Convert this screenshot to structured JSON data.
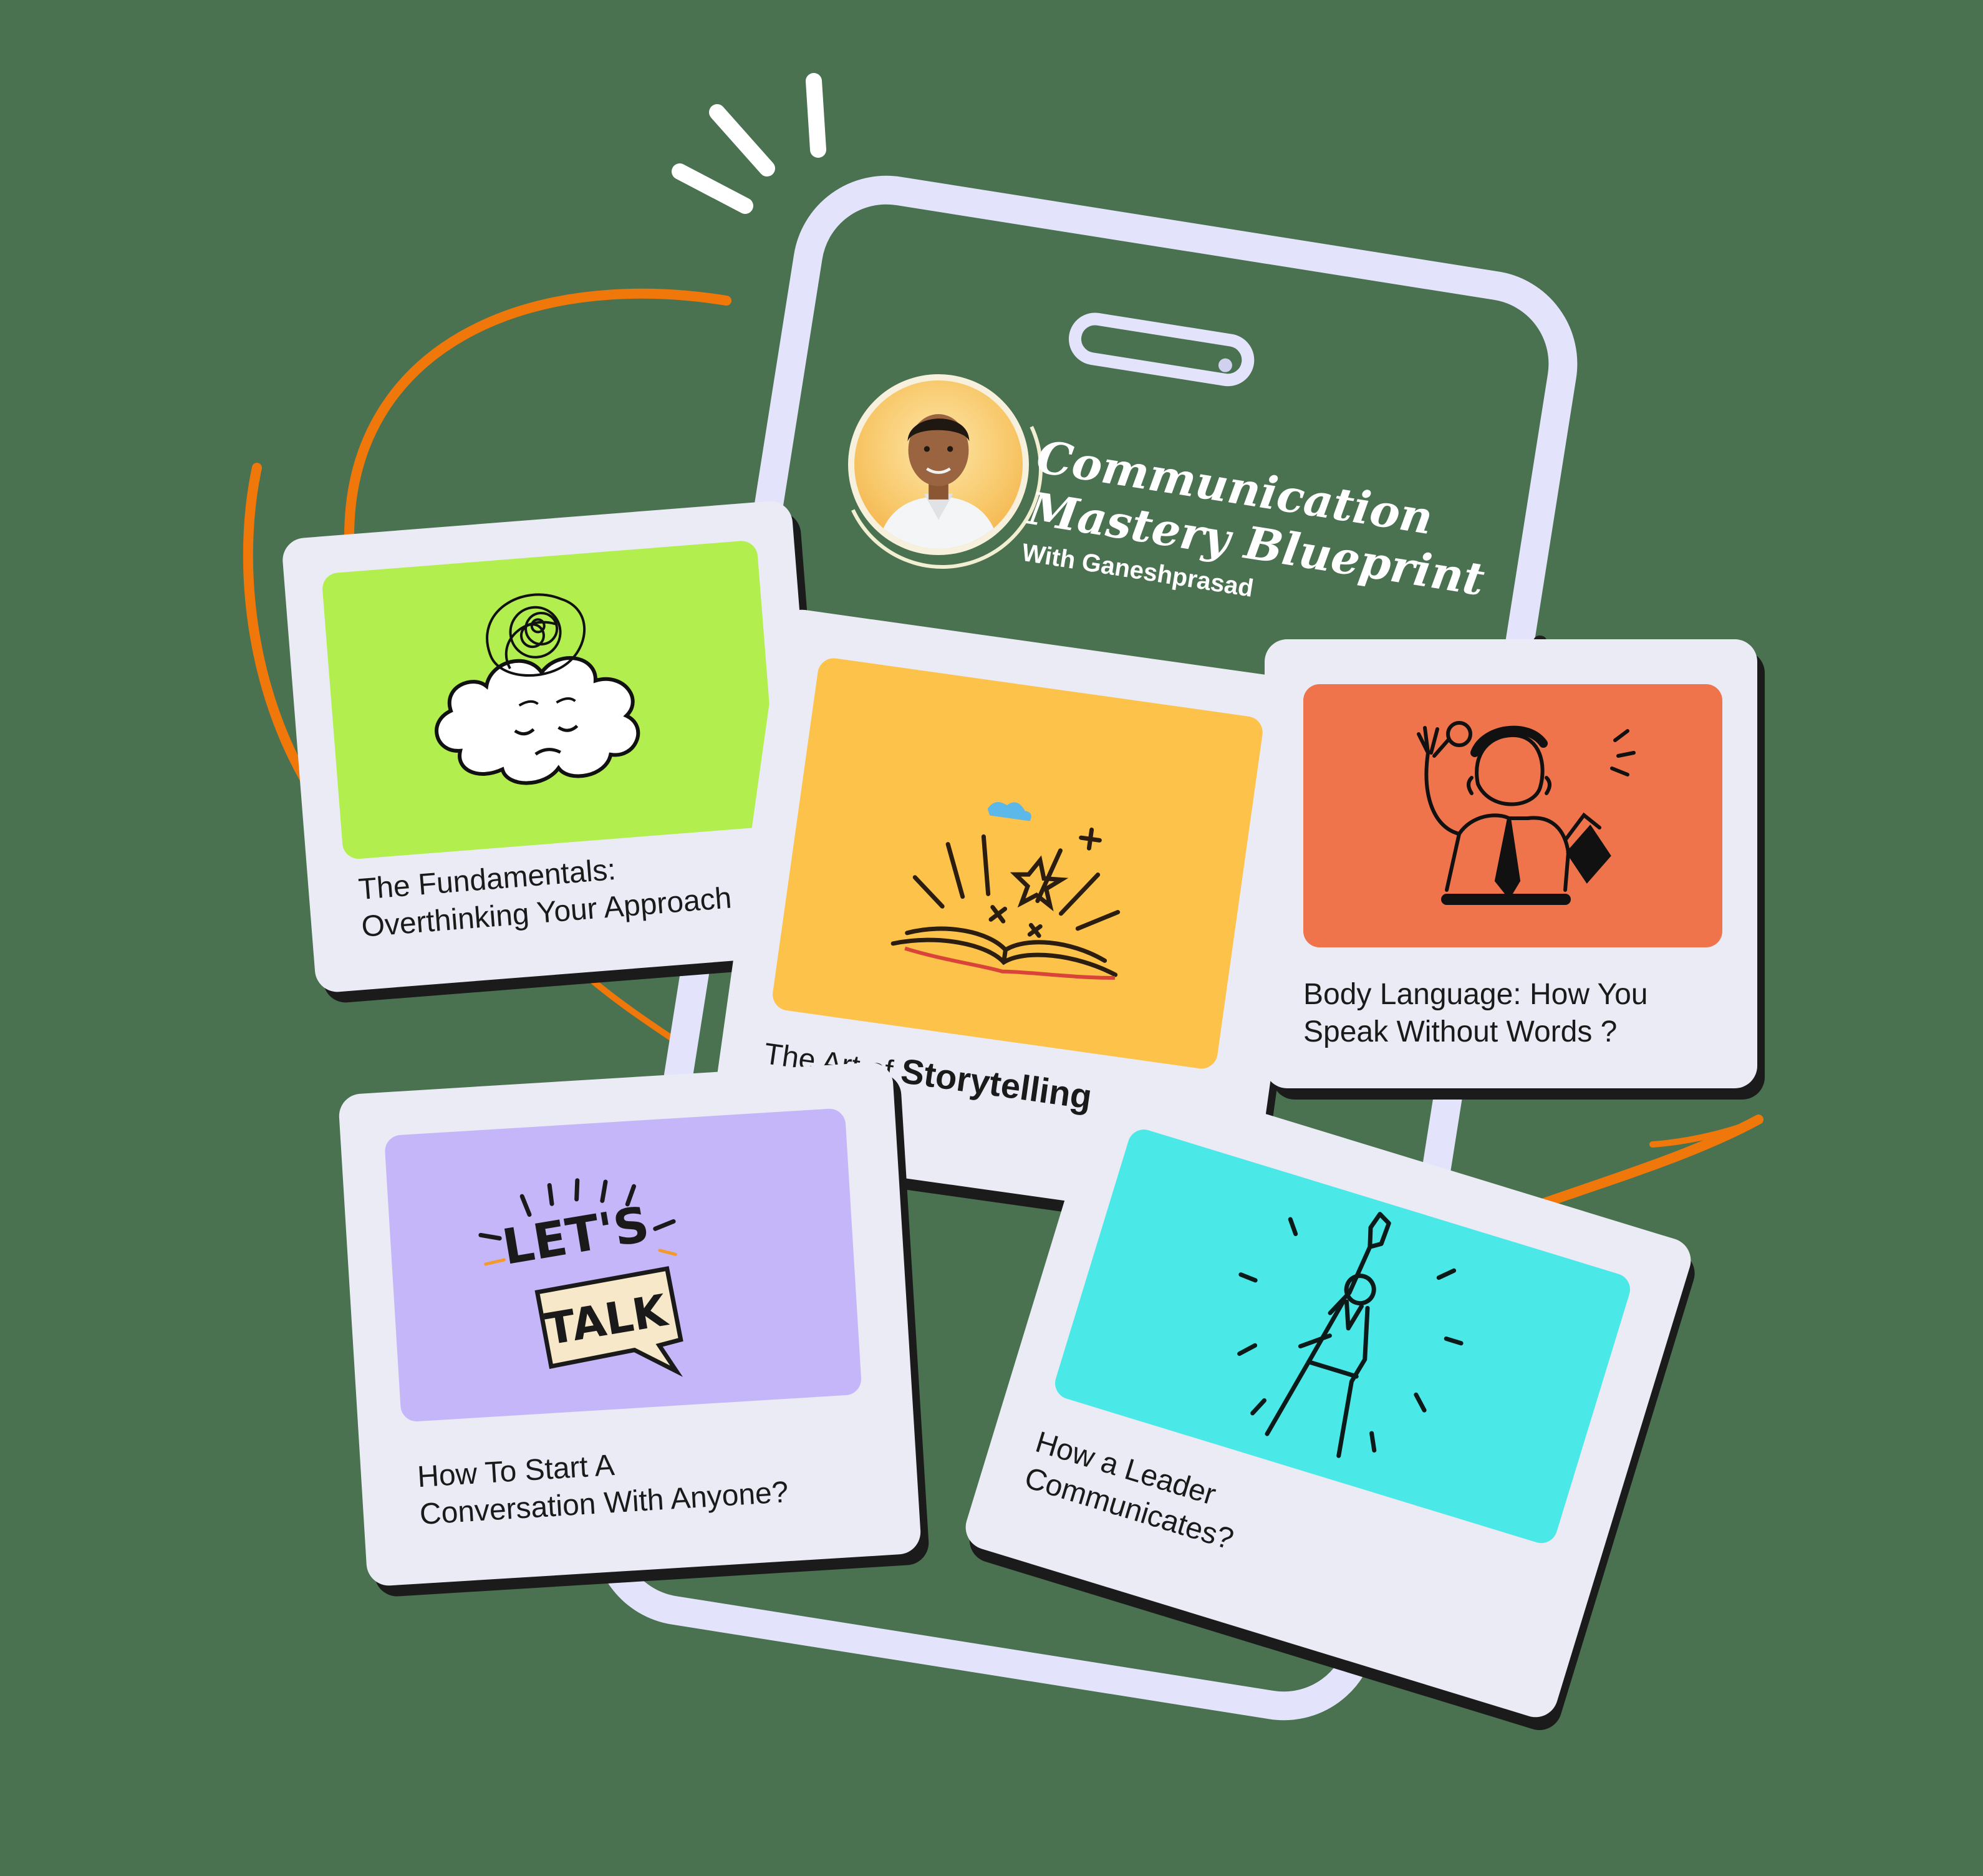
{
  "course": {
    "title_line1": "Communication",
    "title_line2": "Mastery Blueprint",
    "subtitle": "With Ganeshprasad"
  },
  "cards": [
    {
      "label_line1": "The Fundamentals:",
      "label_line2": "Overthinking Your Approach",
      "thumb_color": "#b2ee4e",
      "illustration": "tangled-thought-cloud-icon"
    },
    {
      "label_prefix": "The Art of ",
      "label_bold": "Storytelling",
      "thumb_color": "#fdc24a",
      "illustration": "open-book-sparkles-icon"
    },
    {
      "label_line1": "Body Language: How You",
      "label_line2": "Speak Without Words ?",
      "thumb_color": "#ef744b",
      "illustration": "waving-man-icon"
    },
    {
      "label_line1": "How To Start A",
      "label_line2": "Conversation With Anyone?",
      "thumb_color": "#c5b6f9",
      "illustration": "lets-talk-bubble-icon"
    },
    {
      "label_line1": "How a Leader",
      "label_line2": "Communicates?",
      "thumb_color": "#4be8e8",
      "illustration": "raised-fist-leader-icon"
    }
  ],
  "colors": {
    "background": "#4a7150",
    "accent_orange": "#f0780a",
    "phone_frame": "#e3e4fb",
    "card_bg": "#ebebf6"
  },
  "bubble_text_1": "LET'S",
  "bubble_text_2": "TALK"
}
